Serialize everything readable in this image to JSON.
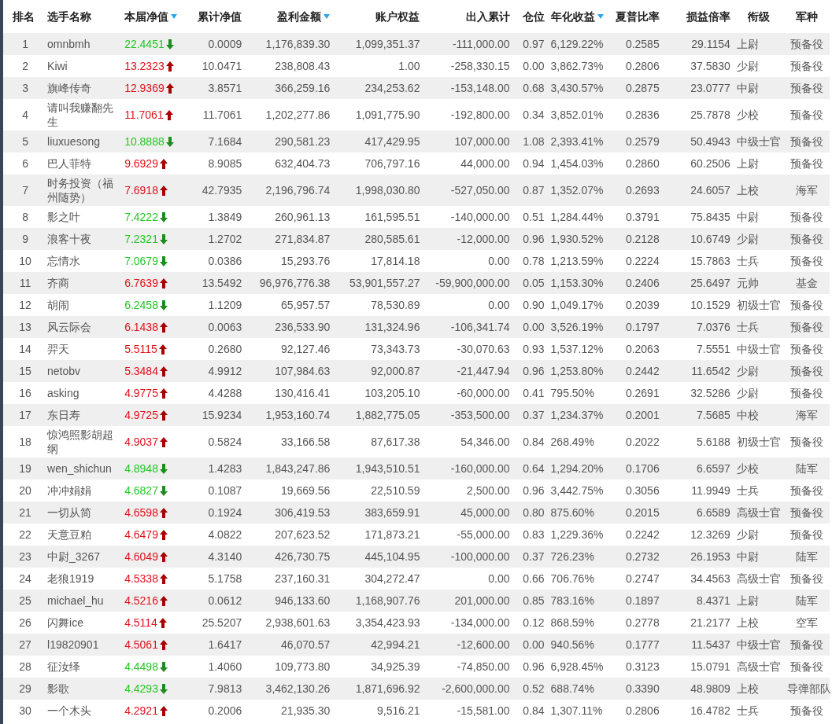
{
  "columns": [
    {
      "label": "排名",
      "sort_marker": false
    },
    {
      "label": "选手名称",
      "sort_marker": false
    },
    {
      "label": "本届净值",
      "sort_marker": true
    },
    {
      "label": "累计净值",
      "sort_marker": false
    },
    {
      "label": "盈利金额",
      "sort_marker": true
    },
    {
      "label": "账户权益",
      "sort_marker": false
    },
    {
      "label": "出入累计",
      "sort_marker": false
    },
    {
      "label": "仓位",
      "sort_marker": false
    },
    {
      "label": "年化收益",
      "sort_marker": true
    },
    {
      "label": "夏普比率",
      "sort_marker": false
    },
    {
      "label": "损益倍率",
      "sort_marker": false
    },
    {
      "label": "衔级",
      "sort_marker": false
    },
    {
      "label": "军种",
      "sort_marker": false
    }
  ],
  "rows": [
    {
      "cells": [
        "1",
        "omnbmh",
        "22.4451",
        "0.0009",
        "1,176,839.30",
        "1,099,351.37",
        "-111,000.00",
        "0.97",
        "6,129.22%",
        "0.2585",
        "29.1154",
        "上尉",
        "预备役"
      ],
      "kind": "down"
    },
    {
      "cells": [
        "2",
        "Kiwi",
        "13.2323",
        "10.0471",
        "238,808.43",
        "1.00",
        "-258,330.15",
        "0.00",
        "3,862.73%",
        "0.2806",
        "37.5830",
        "少尉",
        "预备役"
      ],
      "kind": "up"
    },
    {
      "cells": [
        "3",
        "旗峰传奇",
        "12.9369",
        "3.8571",
        "366,259.16",
        "234,253.62",
        "-153,148.00",
        "0.68",
        "3,430.57%",
        "0.2875",
        "23.0777",
        "中尉",
        "预备役"
      ],
      "kind": "up"
    },
    {
      "cells": [
        "4",
        "请叫我赚翻先生",
        "11.7061",
        "11.7061",
        "1,202,277.86",
        "1,091,775.90",
        "-192,800.00",
        "0.34",
        "3,852.01%",
        "0.2836",
        "25.7878",
        "少校",
        "预备役"
      ],
      "kind": "up"
    },
    {
      "cells": [
        "5",
        "liuxuesong",
        "10.8888",
        "7.1684",
        "290,581.23",
        "417,429.95",
        "107,000.00",
        "1.08",
        "2,393.41%",
        "0.2579",
        "50.4943",
        "中级士官",
        "预备役"
      ],
      "kind": "down"
    },
    {
      "cells": [
        "6",
        "巴人菲特",
        "9.6929",
        "8.9085",
        "632,404.73",
        "706,797.16",
        "44,000.00",
        "0.94",
        "1,454.03%",
        "0.2860",
        "60.2506",
        "上尉",
        "预备役"
      ],
      "kind": "up"
    },
    {
      "cells": [
        "7",
        "时务投资（福州随势）",
        "7.6918",
        "42.7935",
        "2,196,796.74",
        "1,998,030.80",
        "-527,050.00",
        "0.87",
        "1,352.07%",
        "0.2693",
        "24.6057",
        "上校",
        "海军"
      ],
      "kind": "up"
    },
    {
      "cells": [
        "8",
        "影之叶",
        "7.4222",
        "1.3849",
        "260,961.13",
        "161,595.51",
        "-140,000.00",
        "0.51",
        "1,284.44%",
        "0.3791",
        "75.8435",
        "中尉",
        "预备役"
      ],
      "kind": "down"
    },
    {
      "cells": [
        "9",
        "浪客十夜",
        "7.2321",
        "1.2702",
        "271,834.87",
        "280,585.61",
        "-12,000.00",
        "0.96",
        "1,930.52%",
        "0.2128",
        "10.6749",
        "少尉",
        "预备役"
      ],
      "kind": "down"
    },
    {
      "cells": [
        "10",
        "忘情水",
        "7.0679",
        "0.0386",
        "15,293.76",
        "17,814.18",
        "0.00",
        "0.78",
        "1,213.59%",
        "0.2224",
        "15.7863",
        "士兵",
        "预备役"
      ],
      "kind": "down"
    },
    {
      "cells": [
        "11",
        "齐商",
        "6.7639",
        "13.5492",
        "96,976,776.38",
        "53,901,557.27",
        "-59,900,000.00",
        "0.05",
        "1,153.30%",
        "0.2406",
        "25.6497",
        "元帅",
        "基金"
      ],
      "kind": "up"
    },
    {
      "cells": [
        "12",
        "胡闹",
        "6.2458",
        "1.1209",
        "65,957.57",
        "78,530.89",
        "0.00",
        "0.90",
        "1,049.17%",
        "0.2039",
        "10.1529",
        "初级士官",
        "预备役"
      ],
      "kind": "down"
    },
    {
      "cells": [
        "13",
        "风云际会",
        "6.1438",
        "0.0063",
        "236,533.90",
        "131,324.96",
        "-106,341.74",
        "0.00",
        "3,526.19%",
        "0.1797",
        "7.0376",
        "士兵",
        "预备役"
      ],
      "kind": "up"
    },
    {
      "cells": [
        "14",
        "羿天",
        "5.5115",
        "0.2680",
        "92,127.46",
        "73,343.73",
        "-30,070.63",
        "0.93",
        "1,537.12%",
        "0.2063",
        "7.5551",
        "中级士官",
        "预备役"
      ],
      "kind": "up"
    },
    {
      "cells": [
        "15",
        "netobv",
        "5.3484",
        "4.9912",
        "107,984.63",
        "92,000.87",
        "-21,447.94",
        "0.96",
        "1,253.80%",
        "0.2442",
        "11.6542",
        "少尉",
        "预备役"
      ],
      "kind": "up"
    },
    {
      "cells": [
        "16",
        "asking",
        "4.9775",
        "4.4288",
        "130,416.41",
        "103,205.10",
        "-60,000.00",
        "0.41",
        "795.50%",
        "0.2691",
        "32.5286",
        "少尉",
        "预备役"
      ],
      "kind": "up"
    },
    {
      "cells": [
        "17",
        "东日寿",
        "4.9725",
        "15.9234",
        "1,953,160.74",
        "1,882,775.05",
        "-353,500.00",
        "0.37",
        "1,234.37%",
        "0.2001",
        "7.5685",
        "中校",
        "海军"
      ],
      "kind": "up"
    },
    {
      "cells": [
        "18",
        "惊鸿照影胡超纲",
        "4.9037",
        "0.5824",
        "33,166.58",
        "87,617.38",
        "54,346.00",
        "0.84",
        "268.49%",
        "0.2022",
        "5.6188",
        "初级士官",
        "预备役"
      ],
      "kind": "up"
    },
    {
      "cells": [
        "19",
        "wen_shichun",
        "4.8948",
        "1.4283",
        "1,843,247.86",
        "1,943,510.51",
        "-160,000.00",
        "0.64",
        "1,294.20%",
        "0.1706",
        "6.6597",
        "少校",
        "陆军"
      ],
      "kind": "down"
    },
    {
      "cells": [
        "20",
        "冲冲娟娟",
        "4.6827",
        "0.1087",
        "19,669.56",
        "22,510.59",
        "2,500.00",
        "0.96",
        "3,442.75%",
        "0.3056",
        "11.9949",
        "士兵",
        "预备役"
      ],
      "kind": "down"
    },
    {
      "cells": [
        "21",
        "一切从简",
        "4.6598",
        "0.1924",
        "306,419.53",
        "383,659.91",
        "45,000.00",
        "0.80",
        "875.60%",
        "0.2015",
        "6.6589",
        "高级士官",
        "预备役"
      ],
      "kind": "up"
    },
    {
      "cells": [
        "22",
        "天意豆粕",
        "4.6479",
        "4.0822",
        "207,623.52",
        "171,873.21",
        "-55,000.00",
        "0.83",
        "1,229.36%",
        "0.2242",
        "12.3269",
        "少尉",
        "预备役"
      ],
      "kind": "up"
    },
    {
      "cells": [
        "23",
        "中尉_3267",
        "4.6049",
        "4.3140",
        "426,730.75",
        "445,104.95",
        "-100,000.00",
        "0.37",
        "726.23%",
        "0.2732",
        "26.1953",
        "中尉",
        "陆军"
      ],
      "kind": "up"
    },
    {
      "cells": [
        "24",
        "老狼1919",
        "4.5338",
        "5.1758",
        "237,160.31",
        "304,272.47",
        "0.00",
        "0.66",
        "706.76%",
        "0.2747",
        "34.4563",
        "高级士官",
        "预备役"
      ],
      "kind": "up"
    },
    {
      "cells": [
        "25",
        "michael_hu",
        "4.5216",
        "0.0612",
        "946,133.60",
        "1,168,907.76",
        "201,000.00",
        "0.85",
        "783.16%",
        "0.1897",
        "8.4371",
        "上尉",
        "陆军"
      ],
      "kind": "up"
    },
    {
      "cells": [
        "26",
        "闪舞ice",
        "4.5114",
        "25.5207",
        "2,938,601.63",
        "3,354,423.93",
        "-134,000.00",
        "0.12",
        "868.59%",
        "0.2778",
        "21.2177",
        "上校",
        "空军"
      ],
      "kind": "up"
    },
    {
      "cells": [
        "27",
        "l19820901",
        "4.5061",
        "1.6417",
        "46,070.57",
        "42,994.21",
        "-12,600.00",
        "0.00",
        "940.56%",
        "0.1777",
        "11.5437",
        "中级士官",
        "预备役"
      ],
      "kind": "up"
    },
    {
      "cells": [
        "28",
        "征汝绎",
        "4.4498",
        "1.4060",
        "109,773.80",
        "34,925.39",
        "-74,850.00",
        "0.96",
        "6,928.45%",
        "0.3123",
        "15.0791",
        "高级士官",
        "预备役"
      ],
      "kind": "down"
    },
    {
      "cells": [
        "29",
        "影歌",
        "4.4293",
        "7.9813",
        "3,462,130.26",
        "1,871,696.92",
        "-2,600,000.00",
        "0.52",
        "688.74%",
        "0.3390",
        "48.9809",
        "上校",
        "导弹部队"
      ],
      "kind": "down"
    },
    {
      "cells": [
        "30",
        "一个木头",
        "4.2921",
        "0.2006",
        "21,935.30",
        "9,516.21",
        "-15,581.00",
        "0.84",
        "1,307.11%",
        "0.2806",
        "16.4782",
        "士兵",
        "预备役"
      ],
      "kind": "up"
    }
  ]
}
